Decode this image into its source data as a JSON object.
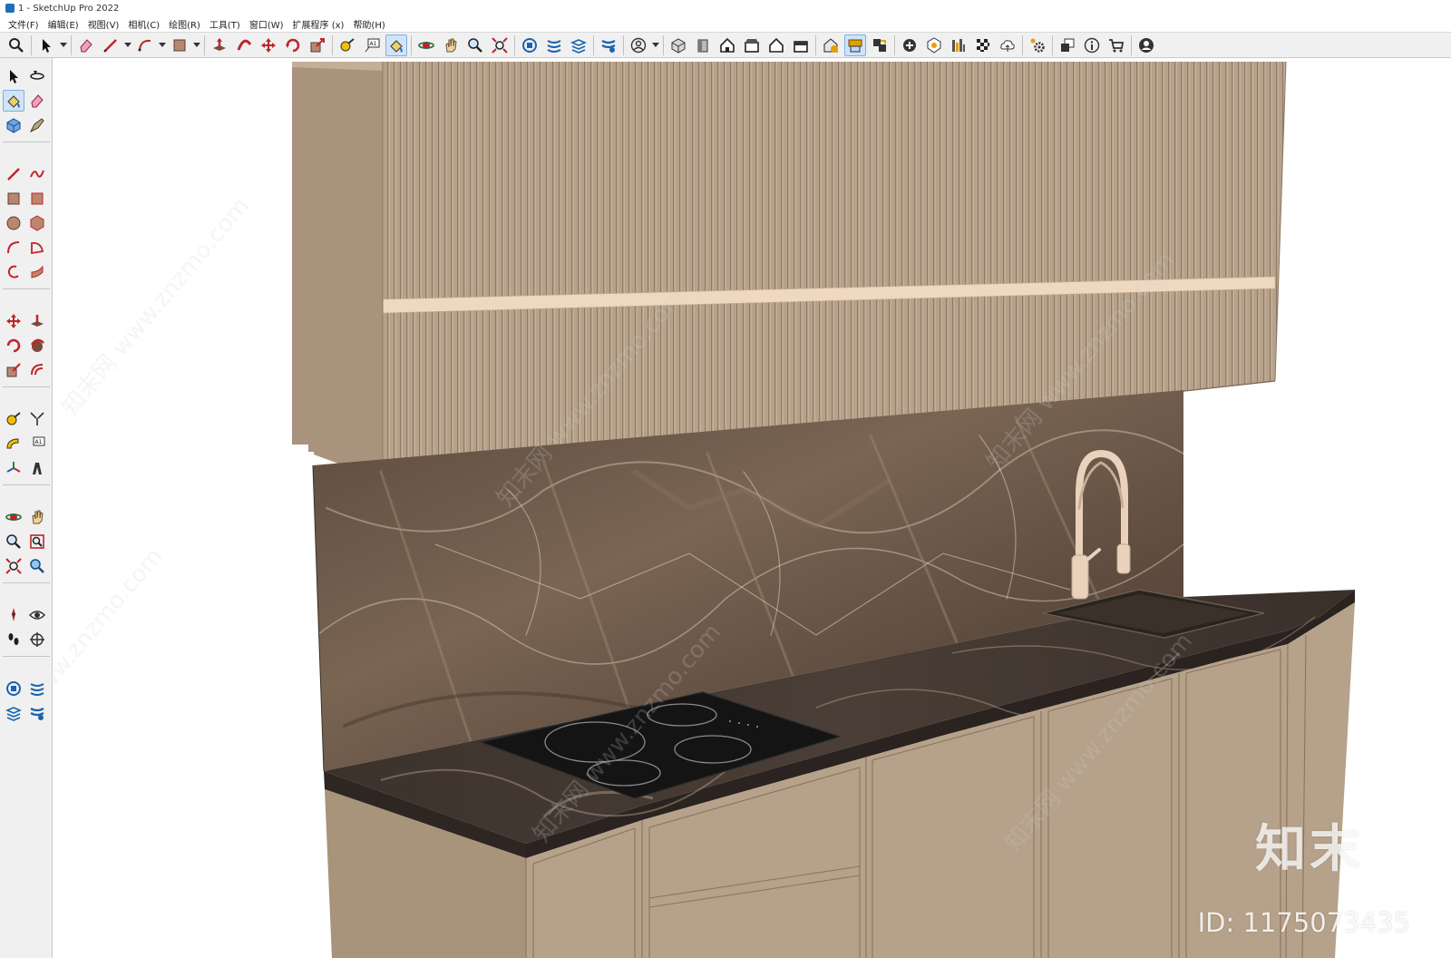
{
  "window": {
    "title": "1 - SketchUp Pro 2022"
  },
  "menu": [
    "文件(F)",
    "编辑(E)",
    "视图(V)",
    "相机(C)",
    "绘图(R)",
    "工具(T)",
    "窗口(W)",
    "扩展程序 (x)",
    "帮助(H)"
  ],
  "toolbar": {
    "icons": [
      "search-icon",
      "select-icon",
      "eraser-icon",
      "pencil-icon",
      "arc-icon",
      "rectangle-icon",
      "push-pull-icon",
      "follow-me-icon",
      "move-icon",
      "rotate-icon",
      "scale-icon",
      "tape-measure-icon",
      "text-icon",
      "paint-bucket-icon",
      "orbit-icon",
      "pan-icon",
      "zoom-icon",
      "zoom-extents-icon",
      "components-icon",
      "materials-icon",
      "styles-icon",
      "layers-icon",
      "user-icon",
      "iso-view-icon",
      "front-view-icon",
      "top-view-icon",
      "right-view-icon",
      "back-view-icon",
      "left-view-icon",
      "warehouse-icon",
      "extension-icon",
      "share-icon",
      "add-location-icon",
      "geo-icon",
      "sandbox-icon",
      "checker-icon",
      "cloud-icon",
      "settings-icon",
      "window-icon",
      "info-icon",
      "cart-icon",
      "account-icon"
    ],
    "active": "extension-icon"
  },
  "left_toolbar": {
    "icons": [
      "select-icon",
      "orbit-small-icon",
      "paint-bucket-icon",
      "eraser-icon",
      "component-icon",
      "tag-icon",
      "line-icon",
      "freehand-icon",
      "rectangle-icon",
      "rotated-rect-icon",
      "circle-icon",
      "polygon-icon",
      "arc-icon",
      "pie-icon",
      "arc2-icon",
      "arc3-icon",
      "move-icon",
      "push-pull-icon",
      "rotate-icon",
      "follow-me-icon",
      "scale-icon",
      "offset-icon",
      "tape-measure-icon",
      "dimension-icon",
      "protractor-icon",
      "text-icon",
      "axes-icon",
      "3d-text-icon",
      "orbit-icon",
      "pan-icon",
      "zoom-icon",
      "zoom-window-icon",
      "zoom-extents-icon",
      "previous-view-icon",
      "position-camera-icon",
      "look-around-icon",
      "walk-icon",
      "section-plane-icon",
      "components-icon",
      "materials-icon",
      "styles-icon",
      "layers-icon"
    ],
    "active": "paint-bucket-icon"
  },
  "scene": {
    "watermark_text": "www.znzmo.com",
    "watermark_cn": "知末网",
    "logo": "知末",
    "id_label": "ID: 1175073435"
  },
  "colors": {
    "cabinet": "#b6a18a",
    "cabinet_dark": "#a48f77",
    "countertop": "#3f3630",
    "backsplash": "#6b5a4d",
    "handle": "#efd8c0",
    "faucet": "#e9d1bc",
    "cooktop": "#141414"
  }
}
